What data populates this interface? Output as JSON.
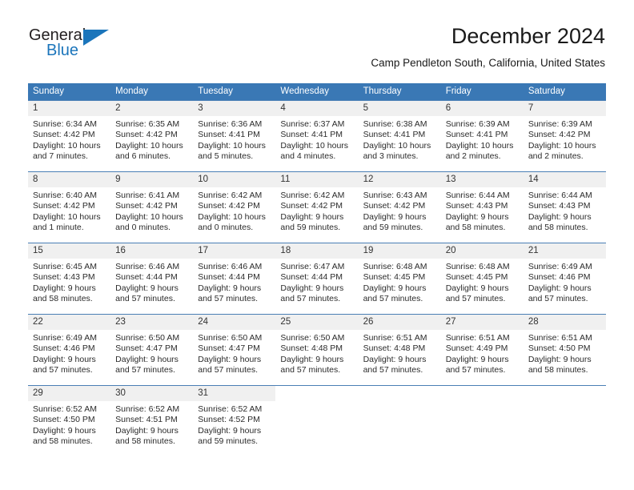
{
  "brand": {
    "name_part1": "General",
    "name_part2": "Blue",
    "triangle_color": "#1b75bb"
  },
  "header": {
    "title": "December 2024",
    "subtitle": "Camp Pendleton South, California, United States"
  },
  "calendar": {
    "header_bg": "#3a78b5",
    "day_band_bg": "#f0f0f0",
    "weekdays": [
      "Sunday",
      "Monday",
      "Tuesday",
      "Wednesday",
      "Thursday",
      "Friday",
      "Saturday"
    ],
    "weeks": [
      [
        {
          "day": "1",
          "sunrise": "Sunrise: 6:34 AM",
          "sunset": "Sunset: 4:42 PM",
          "daylight_1": "Daylight: 10 hours",
          "daylight_2": "and 7 minutes."
        },
        {
          "day": "2",
          "sunrise": "Sunrise: 6:35 AM",
          "sunset": "Sunset: 4:42 PM",
          "daylight_1": "Daylight: 10 hours",
          "daylight_2": "and 6 minutes."
        },
        {
          "day": "3",
          "sunrise": "Sunrise: 6:36 AM",
          "sunset": "Sunset: 4:41 PM",
          "daylight_1": "Daylight: 10 hours",
          "daylight_2": "and 5 minutes."
        },
        {
          "day": "4",
          "sunrise": "Sunrise: 6:37 AM",
          "sunset": "Sunset: 4:41 PM",
          "daylight_1": "Daylight: 10 hours",
          "daylight_2": "and 4 minutes."
        },
        {
          "day": "5",
          "sunrise": "Sunrise: 6:38 AM",
          "sunset": "Sunset: 4:41 PM",
          "daylight_1": "Daylight: 10 hours",
          "daylight_2": "and 3 minutes."
        },
        {
          "day": "6",
          "sunrise": "Sunrise: 6:39 AM",
          "sunset": "Sunset: 4:41 PM",
          "daylight_1": "Daylight: 10 hours",
          "daylight_2": "and 2 minutes."
        },
        {
          "day": "7",
          "sunrise": "Sunrise: 6:39 AM",
          "sunset": "Sunset: 4:42 PM",
          "daylight_1": "Daylight: 10 hours",
          "daylight_2": "and 2 minutes."
        }
      ],
      [
        {
          "day": "8",
          "sunrise": "Sunrise: 6:40 AM",
          "sunset": "Sunset: 4:42 PM",
          "daylight_1": "Daylight: 10 hours",
          "daylight_2": "and 1 minute."
        },
        {
          "day": "9",
          "sunrise": "Sunrise: 6:41 AM",
          "sunset": "Sunset: 4:42 PM",
          "daylight_1": "Daylight: 10 hours",
          "daylight_2": "and 0 minutes."
        },
        {
          "day": "10",
          "sunrise": "Sunrise: 6:42 AM",
          "sunset": "Sunset: 4:42 PM",
          "daylight_1": "Daylight: 10 hours",
          "daylight_2": "and 0 minutes."
        },
        {
          "day": "11",
          "sunrise": "Sunrise: 6:42 AM",
          "sunset": "Sunset: 4:42 PM",
          "daylight_1": "Daylight: 9 hours",
          "daylight_2": "and 59 minutes."
        },
        {
          "day": "12",
          "sunrise": "Sunrise: 6:43 AM",
          "sunset": "Sunset: 4:42 PM",
          "daylight_1": "Daylight: 9 hours",
          "daylight_2": "and 59 minutes."
        },
        {
          "day": "13",
          "sunrise": "Sunrise: 6:44 AM",
          "sunset": "Sunset: 4:43 PM",
          "daylight_1": "Daylight: 9 hours",
          "daylight_2": "and 58 minutes."
        },
        {
          "day": "14",
          "sunrise": "Sunrise: 6:44 AM",
          "sunset": "Sunset: 4:43 PM",
          "daylight_1": "Daylight: 9 hours",
          "daylight_2": "and 58 minutes."
        }
      ],
      [
        {
          "day": "15",
          "sunrise": "Sunrise: 6:45 AM",
          "sunset": "Sunset: 4:43 PM",
          "daylight_1": "Daylight: 9 hours",
          "daylight_2": "and 58 minutes."
        },
        {
          "day": "16",
          "sunrise": "Sunrise: 6:46 AM",
          "sunset": "Sunset: 4:44 PM",
          "daylight_1": "Daylight: 9 hours",
          "daylight_2": "and 57 minutes."
        },
        {
          "day": "17",
          "sunrise": "Sunrise: 6:46 AM",
          "sunset": "Sunset: 4:44 PM",
          "daylight_1": "Daylight: 9 hours",
          "daylight_2": "and 57 minutes."
        },
        {
          "day": "18",
          "sunrise": "Sunrise: 6:47 AM",
          "sunset": "Sunset: 4:44 PM",
          "daylight_1": "Daylight: 9 hours",
          "daylight_2": "and 57 minutes."
        },
        {
          "day": "19",
          "sunrise": "Sunrise: 6:48 AM",
          "sunset": "Sunset: 4:45 PM",
          "daylight_1": "Daylight: 9 hours",
          "daylight_2": "and 57 minutes."
        },
        {
          "day": "20",
          "sunrise": "Sunrise: 6:48 AM",
          "sunset": "Sunset: 4:45 PM",
          "daylight_1": "Daylight: 9 hours",
          "daylight_2": "and 57 minutes."
        },
        {
          "day": "21",
          "sunrise": "Sunrise: 6:49 AM",
          "sunset": "Sunset: 4:46 PM",
          "daylight_1": "Daylight: 9 hours",
          "daylight_2": "and 57 minutes."
        }
      ],
      [
        {
          "day": "22",
          "sunrise": "Sunrise: 6:49 AM",
          "sunset": "Sunset: 4:46 PM",
          "daylight_1": "Daylight: 9 hours",
          "daylight_2": "and 57 minutes."
        },
        {
          "day": "23",
          "sunrise": "Sunrise: 6:50 AM",
          "sunset": "Sunset: 4:47 PM",
          "daylight_1": "Daylight: 9 hours",
          "daylight_2": "and 57 minutes."
        },
        {
          "day": "24",
          "sunrise": "Sunrise: 6:50 AM",
          "sunset": "Sunset: 4:47 PM",
          "daylight_1": "Daylight: 9 hours",
          "daylight_2": "and 57 minutes."
        },
        {
          "day": "25",
          "sunrise": "Sunrise: 6:50 AM",
          "sunset": "Sunset: 4:48 PM",
          "daylight_1": "Daylight: 9 hours",
          "daylight_2": "and 57 minutes."
        },
        {
          "day": "26",
          "sunrise": "Sunrise: 6:51 AM",
          "sunset": "Sunset: 4:48 PM",
          "daylight_1": "Daylight: 9 hours",
          "daylight_2": "and 57 minutes."
        },
        {
          "day": "27",
          "sunrise": "Sunrise: 6:51 AM",
          "sunset": "Sunset: 4:49 PM",
          "daylight_1": "Daylight: 9 hours",
          "daylight_2": "and 57 minutes."
        },
        {
          "day": "28",
          "sunrise": "Sunrise: 6:51 AM",
          "sunset": "Sunset: 4:50 PM",
          "daylight_1": "Daylight: 9 hours",
          "daylight_2": "and 58 minutes."
        }
      ],
      [
        {
          "day": "29",
          "sunrise": "Sunrise: 6:52 AM",
          "sunset": "Sunset: 4:50 PM",
          "daylight_1": "Daylight: 9 hours",
          "daylight_2": "and 58 minutes."
        },
        {
          "day": "30",
          "sunrise": "Sunrise: 6:52 AM",
          "sunset": "Sunset: 4:51 PM",
          "daylight_1": "Daylight: 9 hours",
          "daylight_2": "and 58 minutes."
        },
        {
          "day": "31",
          "sunrise": "Sunrise: 6:52 AM",
          "sunset": "Sunset: 4:52 PM",
          "daylight_1": "Daylight: 9 hours",
          "daylight_2": "and 59 minutes."
        },
        {
          "day": "",
          "sunrise": "",
          "sunset": "",
          "daylight_1": "",
          "daylight_2": ""
        },
        {
          "day": "",
          "sunrise": "",
          "sunset": "",
          "daylight_1": "",
          "daylight_2": ""
        },
        {
          "day": "",
          "sunrise": "",
          "sunset": "",
          "daylight_1": "",
          "daylight_2": ""
        },
        {
          "day": "",
          "sunrise": "",
          "sunset": "",
          "daylight_1": "",
          "daylight_2": ""
        }
      ]
    ]
  }
}
